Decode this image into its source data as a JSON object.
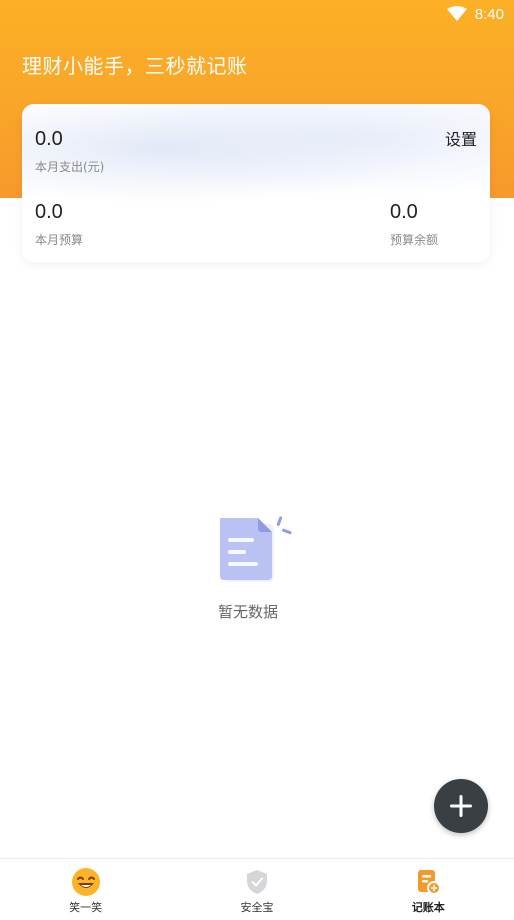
{
  "status_bar": {
    "time": "8:40",
    "wifi_icon": "wifi-icon"
  },
  "header": {
    "slogan": "理财小能手，三秒就记账"
  },
  "summary_card": {
    "month_expense_value": "0.0",
    "month_expense_label": "本月支出(元)",
    "settings_label": "设置",
    "month_budget_value": "0.0",
    "month_budget_label": "本月预算",
    "budget_remaining_value": "0.0",
    "budget_remaining_label": "预算余额"
  },
  "empty_state": {
    "icon": "empty-document-icon",
    "text": "暂无数据"
  },
  "fab": {
    "icon": "plus-icon"
  },
  "tabs": [
    {
      "label": "笑一笑",
      "icon": "smile-icon",
      "active": false
    },
    {
      "label": "安全宝",
      "icon": "shield-icon",
      "active": false
    },
    {
      "label": "记账本",
      "icon": "ledger-icon",
      "active": true
    }
  ],
  "colors": {
    "header": "#f9a52a",
    "fab": "#3a3f44",
    "accent": "#f39a2a"
  }
}
